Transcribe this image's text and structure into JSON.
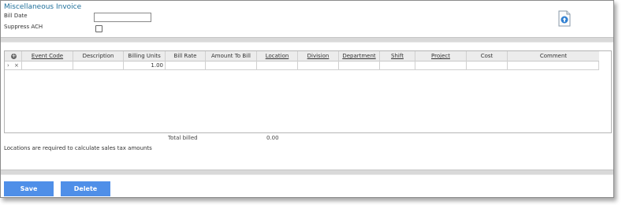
{
  "form": {
    "title": "Miscellaneous Invoice",
    "bill_date_label": "Bill Date",
    "bill_date_value": "",
    "suppress_ach_label": "Suppress ACH",
    "suppress_ach_checked": false,
    "document_icon": "document-upload-icon"
  },
  "grid": {
    "add_icon": "add-circle-icon",
    "columns": [
      {
        "label": "Event Code",
        "link": true
      },
      {
        "label": "Description",
        "link": false
      },
      {
        "label": "Billing Units",
        "link": false
      },
      {
        "label": "Bill Rate",
        "link": false
      },
      {
        "label": "Amount To Bill",
        "link": false
      },
      {
        "label": "Location",
        "link": true
      },
      {
        "label": "Division",
        "link": true
      },
      {
        "label": "Department",
        "link": true
      },
      {
        "label": "Shift",
        "link": true
      },
      {
        "label": "Project",
        "link": true
      },
      {
        "label": "Cost",
        "link": false
      },
      {
        "label": "Comment",
        "link": false
      }
    ],
    "rows": [
      {
        "expand": "›",
        "remove": "×",
        "billing_units": "1.00"
      }
    ]
  },
  "totals": {
    "label": "Total billed",
    "value": "0.00"
  },
  "note": "Locations are required to calculate sales tax amounts",
  "buttons": {
    "save": "Save",
    "delete": "Delete"
  },
  "colors": {
    "title": "#1f6f9a",
    "button": "#4f8fe8"
  }
}
